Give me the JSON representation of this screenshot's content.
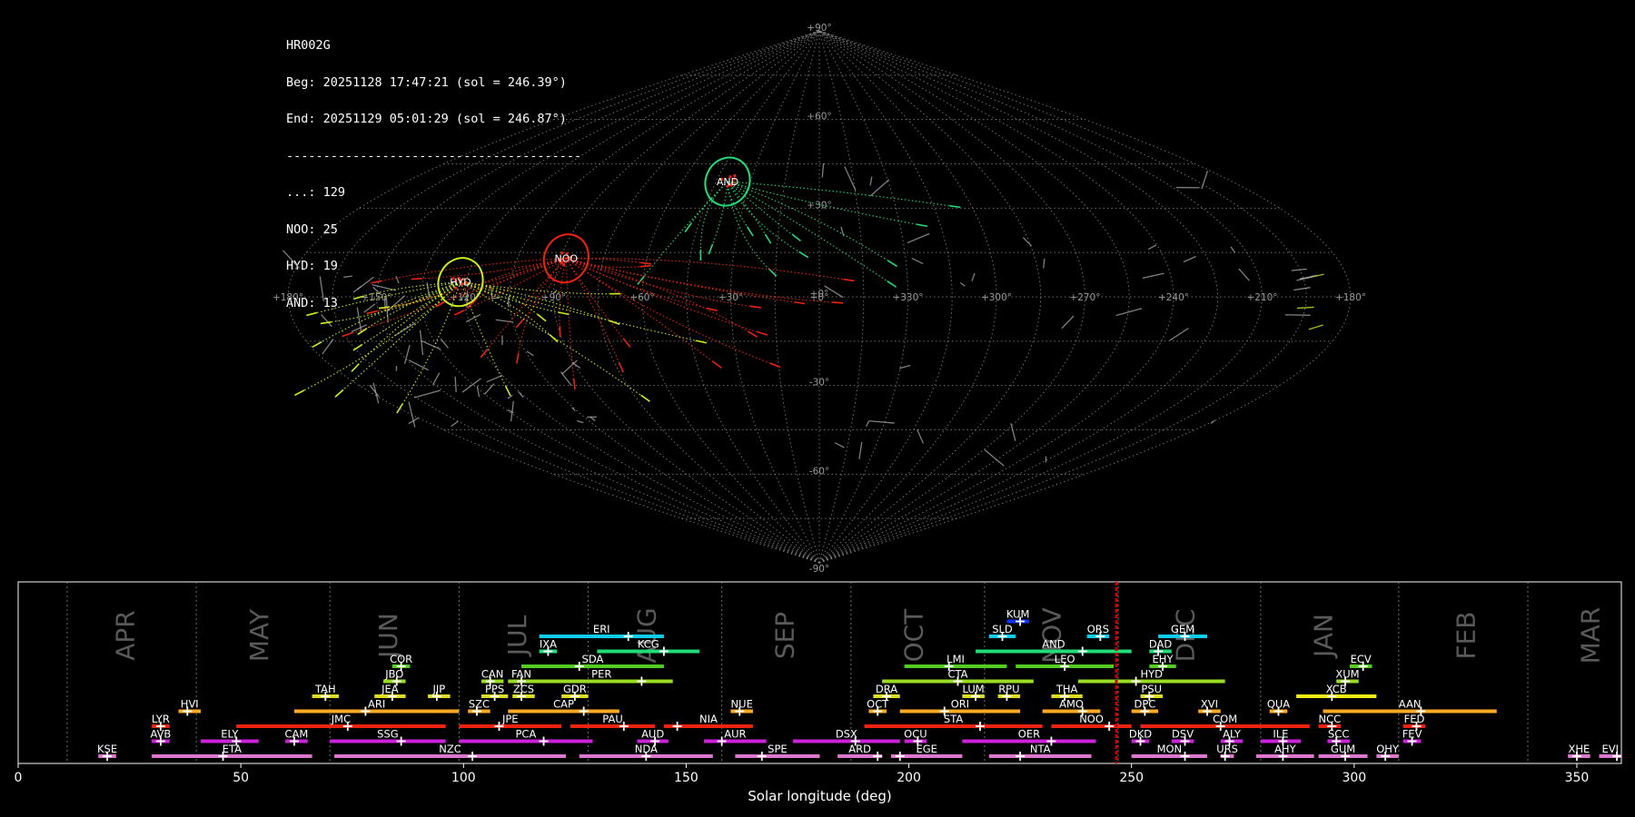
{
  "header": {
    "camera": "HR002G",
    "begin": "Beg: 20251128 17:47:21 (sol = 246.39°)",
    "end": "End: 20251129 05:01:29 (sol = 246.87°)",
    "separator": "----------------------------------------",
    "counts": [
      {
        "label": "...: 129"
      },
      {
        "label": "NOO: 25"
      },
      {
        "label": "HYD: 19"
      },
      {
        "label": "AND: 13"
      }
    ]
  },
  "colors": {
    "background": "#000000",
    "grid": "#8a8a8a",
    "AND": "#22dd77",
    "NOO": "#ee2211",
    "HYD": "#ccee22",
    "sporadic": "#aaaaaa",
    "current_sol": "#cc0000"
  },
  "chart_data": [
    {
      "type": "scatter",
      "projection": "sinusoidal",
      "lon_labels": [
        "+180°",
        "+150°",
        "+120°",
        "+90°",
        "+60°",
        "+30°",
        "+0°",
        "+330°",
        "+300°",
        "+270°",
        "+240°",
        "+210°",
        "+180°"
      ],
      "lat_labels": [
        "+90°",
        "+60°",
        "+30°",
        "+0°",
        "-30°",
        "-60°",
        "-90°"
      ],
      "radiants": [
        {
          "name": "AND",
          "lon": 40,
          "lat": 39
        },
        {
          "name": "NOO",
          "lon": 88,
          "lat": 13
        },
        {
          "name": "HYD",
          "lon": 122,
          "lat": 5
        }
      ]
    },
    {
      "type": "timeline",
      "xlabel": "Solar longitude (deg)",
      "xlim": [
        0,
        360
      ],
      "xticks": [
        "0",
        "50",
        "100",
        "150",
        "200",
        "250",
        "300",
        "350"
      ],
      "current_sol": 246.6,
      "months": [
        {
          "label": "APR",
          "sol": 24
        },
        {
          "label": "MAY",
          "sol": 54
        },
        {
          "label": "JUN",
          "sol": 83
        },
        {
          "label": "JUL",
          "sol": 112
        },
        {
          "label": "AUG",
          "sol": 141
        },
        {
          "label": "SEP",
          "sol": 172
        },
        {
          "label": "OCT",
          "sol": 201
        },
        {
          "label": "NOV",
          "sol": 232
        },
        {
          "label": "DEC",
          "sol": 262
        },
        {
          "label": "JAN",
          "sol": 293
        },
        {
          "label": "FEB",
          "sol": 325
        },
        {
          "label": "MAR",
          "sol": 353
        }
      ],
      "month_boundaries": [
        11,
        40,
        70,
        99,
        128,
        158,
        187,
        217,
        247,
        279,
        310,
        339
      ],
      "showers": [
        {
          "code": "KUM",
          "start": 222,
          "end": 227,
          "peak": 225,
          "row": 10,
          "color": "#1133ee"
        },
        {
          "code": "ERI",
          "start": 117,
          "end": 145,
          "peak": 137,
          "row": 9,
          "color": "#11ccee"
        },
        {
          "code": "SLD",
          "start": 218,
          "end": 224,
          "peak": 221,
          "row": 9,
          "color": "#11ccee"
        },
        {
          "code": "ORS",
          "start": 240,
          "end": 245,
          "peak": 243,
          "row": 9,
          "color": "#11ccee"
        },
        {
          "code": "GEM",
          "start": 256,
          "end": 267,
          "peak": 262,
          "row": 9,
          "color": "#11ccee"
        },
        {
          "code": "IXA",
          "start": 117,
          "end": 121,
          "peak": 119,
          "row": 8,
          "color": "#22dd77"
        },
        {
          "code": "KCG",
          "start": 130,
          "end": 153,
          "peak": 145,
          "row": 8,
          "color": "#22dd77"
        },
        {
          "code": "AND",
          "start": 215,
          "end": 250,
          "peak": 239,
          "row": 8,
          "color": "#22dd77"
        },
        {
          "code": "DAD",
          "start": 254,
          "end": 259,
          "peak": 256,
          "row": 8,
          "color": "#22dd77"
        },
        {
          "code": "COR",
          "start": 84,
          "end": 88,
          "peak": 86,
          "row": 7,
          "color": "#55cc22"
        },
        {
          "code": "SDA",
          "start": 113,
          "end": 145,
          "peak": 126,
          "row": 7,
          "color": "#55cc22"
        },
        {
          "code": "LMI",
          "start": 199,
          "end": 222,
          "peak": 209,
          "row": 7,
          "color": "#55cc22"
        },
        {
          "code": "LEO",
          "start": 224,
          "end": 246,
          "peak": 235,
          "row": 7,
          "color": "#55cc22"
        },
        {
          "code": "EHY",
          "start": 254,
          "end": 260,
          "peak": 257,
          "row": 7,
          "color": "#55cc22"
        },
        {
          "code": "ECV",
          "start": 299,
          "end": 304,
          "peak": 302,
          "row": 7,
          "color": "#55cc22"
        },
        {
          "code": "JBO",
          "start": 82,
          "end": 87,
          "peak": 85,
          "row": 6,
          "color": "#99dd22"
        },
        {
          "code": "CAN",
          "start": 104,
          "end": 109,
          "peak": 106,
          "row": 6,
          "color": "#99dd22"
        },
        {
          "code": "FAN",
          "start": 110,
          "end": 116,
          "peak": 113,
          "row": 6,
          "color": "#99dd22"
        },
        {
          "code": "PER",
          "start": 115,
          "end": 147,
          "peak": 140,
          "row": 6,
          "color": "#99dd22"
        },
        {
          "code": "CTA",
          "start": 194,
          "end": 228,
          "peak": 211,
          "row": 6,
          "color": "#99dd22"
        },
        {
          "code": "HYD",
          "start": 238,
          "end": 271,
          "peak": 251,
          "row": 6,
          "color": "#99dd22"
        },
        {
          "code": "XUM",
          "start": 296,
          "end": 301,
          "peak": 298,
          "row": 6,
          "color": "#99dd22"
        },
        {
          "code": "TAH",
          "start": 66,
          "end": 72,
          "peak": 69,
          "row": 5,
          "color": "#dddd22"
        },
        {
          "code": "JEA",
          "start": 80,
          "end": 87,
          "peak": 84,
          "row": 5,
          "color": "#dddd22"
        },
        {
          "code": "JIP",
          "start": 92,
          "end": 97,
          "peak": 94,
          "row": 5,
          "color": "#dddd22"
        },
        {
          "code": "PPS",
          "start": 104,
          "end": 110,
          "peak": 107,
          "row": 5,
          "color": "#dddd22"
        },
        {
          "code": "ZCS",
          "start": 111,
          "end": 116,
          "peak": 113,
          "row": 5,
          "color": "#dddd22"
        },
        {
          "code": "GDR",
          "start": 122,
          "end": 128,
          "peak": 125,
          "row": 5,
          "color": "#dddd22"
        },
        {
          "code": "DRA",
          "start": 192,
          "end": 198,
          "peak": 195,
          "row": 5,
          "color": "#dddd22"
        },
        {
          "code": "LUM",
          "start": 212,
          "end": 217,
          "peak": 215,
          "row": 5,
          "color": "#dddd22"
        },
        {
          "code": "RPU",
          "start": 220,
          "end": 225,
          "peak": 222,
          "row": 5,
          "color": "#dddd22"
        },
        {
          "code": "THA",
          "start": 232,
          "end": 239,
          "peak": 235,
          "row": 5,
          "color": "#dddd22"
        },
        {
          "code": "PSU",
          "start": 252,
          "end": 257,
          "peak": 254,
          "row": 5,
          "color": "#dddd22"
        },
        {
          "code": "XCB",
          "start": 287,
          "end": 305,
          "peak": 295,
          "row": 5,
          "color": "#eeee11"
        },
        {
          "code": "HVI",
          "start": 36,
          "end": 41,
          "peak": 38,
          "row": 4,
          "color": "#ffaa22"
        },
        {
          "code": "ARI",
          "start": 62,
          "end": 99,
          "peak": 78,
          "row": 4,
          "color": "#ffaa22"
        },
        {
          "code": "SZC",
          "start": 101,
          "end": 106,
          "peak": 103,
          "row": 4,
          "color": "#ffaa22"
        },
        {
          "code": "CAP",
          "start": 110,
          "end": 135,
          "peak": 127,
          "row": 4,
          "color": "#ffaa22"
        },
        {
          "code": "NUE",
          "start": 160,
          "end": 165,
          "peak": 162,
          "row": 4,
          "color": "#ffaa22"
        },
        {
          "code": "OCT",
          "start": 191,
          "end": 195,
          "peak": 193,
          "row": 4,
          "color": "#ffaa22"
        },
        {
          "code": "ORI",
          "start": 198,
          "end": 225,
          "peak": 208,
          "row": 4,
          "color": "#ffaa22"
        },
        {
          "code": "AMO",
          "start": 230,
          "end": 243,
          "peak": 239,
          "row": 4,
          "color": "#ffaa22"
        },
        {
          "code": "DPC",
          "start": 250,
          "end": 256,
          "peak": 253,
          "row": 4,
          "color": "#ffaa22"
        },
        {
          "code": "XVI",
          "start": 265,
          "end": 270,
          "peak": 267,
          "row": 4,
          "color": "#ffaa22"
        },
        {
          "code": "QUA",
          "start": 281,
          "end": 285,
          "peak": 283,
          "row": 4,
          "color": "#ffaa22"
        },
        {
          "code": "AAN",
          "start": 293,
          "end": 332,
          "peak": 315,
          "row": 4,
          "color": "#ffaa22"
        },
        {
          "code": "LYR",
          "start": 30,
          "end": 34,
          "peak": 32,
          "row": 3,
          "color": "#ee2211"
        },
        {
          "code": "JMC",
          "start": 49,
          "end": 96,
          "peak": 74,
          "row": 3,
          "color": "#ee2211"
        },
        {
          "code": "JPE",
          "start": 99,
          "end": 122,
          "peak": 108,
          "row": 3,
          "color": "#ee2211"
        },
        {
          "code": "PAU",
          "start": 124,
          "end": 143,
          "peak": 136,
          "row": 3,
          "color": "#ee2211"
        },
        {
          "code": "NIA",
          "start": 145,
          "end": 165,
          "peak": 148,
          "row": 3,
          "color": "#ee2211"
        },
        {
          "code": "STA",
          "start": 190,
          "end": 230,
          "peak": 216,
          "row": 3,
          "color": "#ee2211"
        },
        {
          "code": "NOO",
          "start": 232,
          "end": 250,
          "peak": 245,
          "row": 3,
          "color": "#ee2211"
        },
        {
          "code": "COM",
          "start": 252,
          "end": 290,
          "peak": 270,
          "row": 3,
          "color": "#ee2211"
        },
        {
          "code": "NCC",
          "start": 292,
          "end": 297,
          "peak": 295,
          "row": 3,
          "color": "#ee2211"
        },
        {
          "code": "FED",
          "start": 311,
          "end": 316,
          "peak": 314,
          "row": 3,
          "color": "#ee2211"
        },
        {
          "code": "AVB",
          "start": 30,
          "end": 34,
          "peak": 32,
          "row": 2,
          "color": "#cc22dd"
        },
        {
          "code": "ELY",
          "start": 41,
          "end": 54,
          "peak": 49,
          "row": 2,
          "color": "#cc22dd"
        },
        {
          "code": "CAM",
          "start": 60,
          "end": 65,
          "peak": 62,
          "row": 2,
          "color": "#cc22dd"
        },
        {
          "code": "SSG",
          "start": 70,
          "end": 96,
          "peak": 86,
          "row": 2,
          "color": "#cc22dd"
        },
        {
          "code": "PCA",
          "start": 99,
          "end": 129,
          "peak": 118,
          "row": 2,
          "color": "#cc22dd"
        },
        {
          "code": "AUD",
          "start": 139,
          "end": 146,
          "peak": 143,
          "row": 2,
          "color": "#cc22dd"
        },
        {
          "code": "AUR",
          "start": 154,
          "end": 168,
          "peak": 158,
          "row": 2,
          "color": "#cc22dd"
        },
        {
          "code": "DSX",
          "start": 174,
          "end": 198,
          "peak": 188,
          "row": 2,
          "color": "#cc22dd"
        },
        {
          "code": "OCU",
          "start": 199,
          "end": 204,
          "peak": 202,
          "row": 2,
          "color": "#cc22dd"
        },
        {
          "code": "OER",
          "start": 212,
          "end": 242,
          "peak": 232,
          "row": 2,
          "color": "#cc22dd"
        },
        {
          "code": "DKD",
          "start": 250,
          "end": 254,
          "peak": 252,
          "row": 2,
          "color": "#cc22dd"
        },
        {
          "code": "DSV",
          "start": 259,
          "end": 264,
          "peak": 262,
          "row": 2,
          "color": "#cc22dd"
        },
        {
          "code": "ALY",
          "start": 270,
          "end": 275,
          "peak": 272,
          "row": 2,
          "color": "#cc22dd"
        },
        {
          "code": "ILE",
          "start": 279,
          "end": 288,
          "peak": 284,
          "row": 2,
          "color": "#cc22dd"
        },
        {
          "code": "SCC",
          "start": 294,
          "end": 299,
          "peak": 296,
          "row": 2,
          "color": "#cc22dd"
        },
        {
          "code": "FEV",
          "start": 311,
          "end": 315,
          "peak": 313,
          "row": 2,
          "color": "#cc22dd"
        },
        {
          "code": "KSE",
          "start": 18,
          "end": 22,
          "peak": 20,
          "row": 1,
          "color": "#dd77cc"
        },
        {
          "code": "ETA",
          "start": 30,
          "end": 66,
          "peak": 46,
          "row": 1,
          "color": "#dd77cc"
        },
        {
          "code": "NZC",
          "start": 71,
          "end": 123,
          "peak": 102,
          "row": 1,
          "color": "#dd77cc"
        },
        {
          "code": "NDA",
          "start": 126,
          "end": 156,
          "peak": 141,
          "row": 1,
          "color": "#dd77cc"
        },
        {
          "code": "SPE",
          "start": 161,
          "end": 180,
          "peak": 167,
          "row": 1,
          "color": "#dd77cc"
        },
        {
          "code": "ARD",
          "start": 184,
          "end": 194,
          "peak": 193,
          "row": 1,
          "color": "#dd77cc"
        },
        {
          "code": "EGE",
          "start": 196,
          "end": 212,
          "peak": 198,
          "row": 1,
          "color": "#dd77cc"
        },
        {
          "code": "NTA",
          "start": 218,
          "end": 241,
          "peak": 225,
          "row": 1,
          "color": "#dd77cc"
        },
        {
          "code": "MON",
          "start": 250,
          "end": 267,
          "peak": 262,
          "row": 1,
          "color": "#dd77cc"
        },
        {
          "code": "URS",
          "start": 270,
          "end": 273,
          "peak": 271,
          "row": 1,
          "color": "#dd77cc"
        },
        {
          "code": "AHY",
          "start": 278,
          "end": 291,
          "peak": 284,
          "row": 1,
          "color": "#dd77cc"
        },
        {
          "code": "GUM",
          "start": 292,
          "end": 303,
          "peak": 298,
          "row": 1,
          "color": "#dd77cc"
        },
        {
          "code": "OHY",
          "start": 305,
          "end": 310,
          "peak": 307,
          "row": 1,
          "color": "#dd77cc"
        },
        {
          "code": "XHE",
          "start": 348,
          "end": 353,
          "peak": 350,
          "row": 1,
          "color": "#dd77cc"
        },
        {
          "code": "EVI",
          "start": 355,
          "end": 360,
          "peak": 359,
          "row": 1,
          "color": "#dd77cc"
        }
      ]
    }
  ]
}
